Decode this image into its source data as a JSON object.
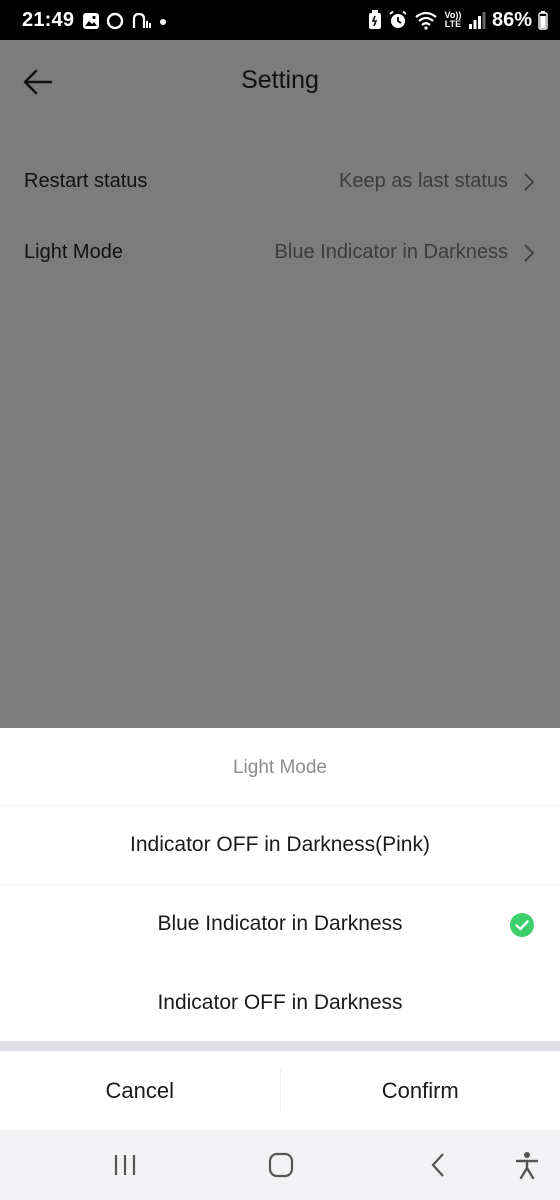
{
  "status_bar": {
    "time": "21:49",
    "battery": "86%",
    "network_label": "Vo)) LTE"
  },
  "header": {
    "title": "Setting"
  },
  "settings": [
    {
      "label": "Restart status",
      "value": "Keep as last status"
    },
    {
      "label": "Light Mode",
      "value": "Blue Indicator in Darkness"
    }
  ],
  "sheet": {
    "title": "Light Mode",
    "options": [
      {
        "label": "Indicator OFF in Darkness(Pink)",
        "selected": false
      },
      {
        "label": "Blue Indicator in Darkness",
        "selected": true
      },
      {
        "label": "Indicator OFF in Darkness",
        "selected": false
      }
    ],
    "cancel_label": "Cancel",
    "confirm_label": "Confirm"
  },
  "colors": {
    "accent_check": "#3ccf6b",
    "overlay": "#7c7c7c"
  },
  "icons": {
    "back": "arrow-left-icon",
    "chevron": "chevron-right-icon",
    "check": "check-circle-icon",
    "nav_recent": "recent-apps-icon",
    "nav_home": "home-icon",
    "nav_back": "back-chevron-icon",
    "nav_accessibility": "accessibility-icon"
  }
}
